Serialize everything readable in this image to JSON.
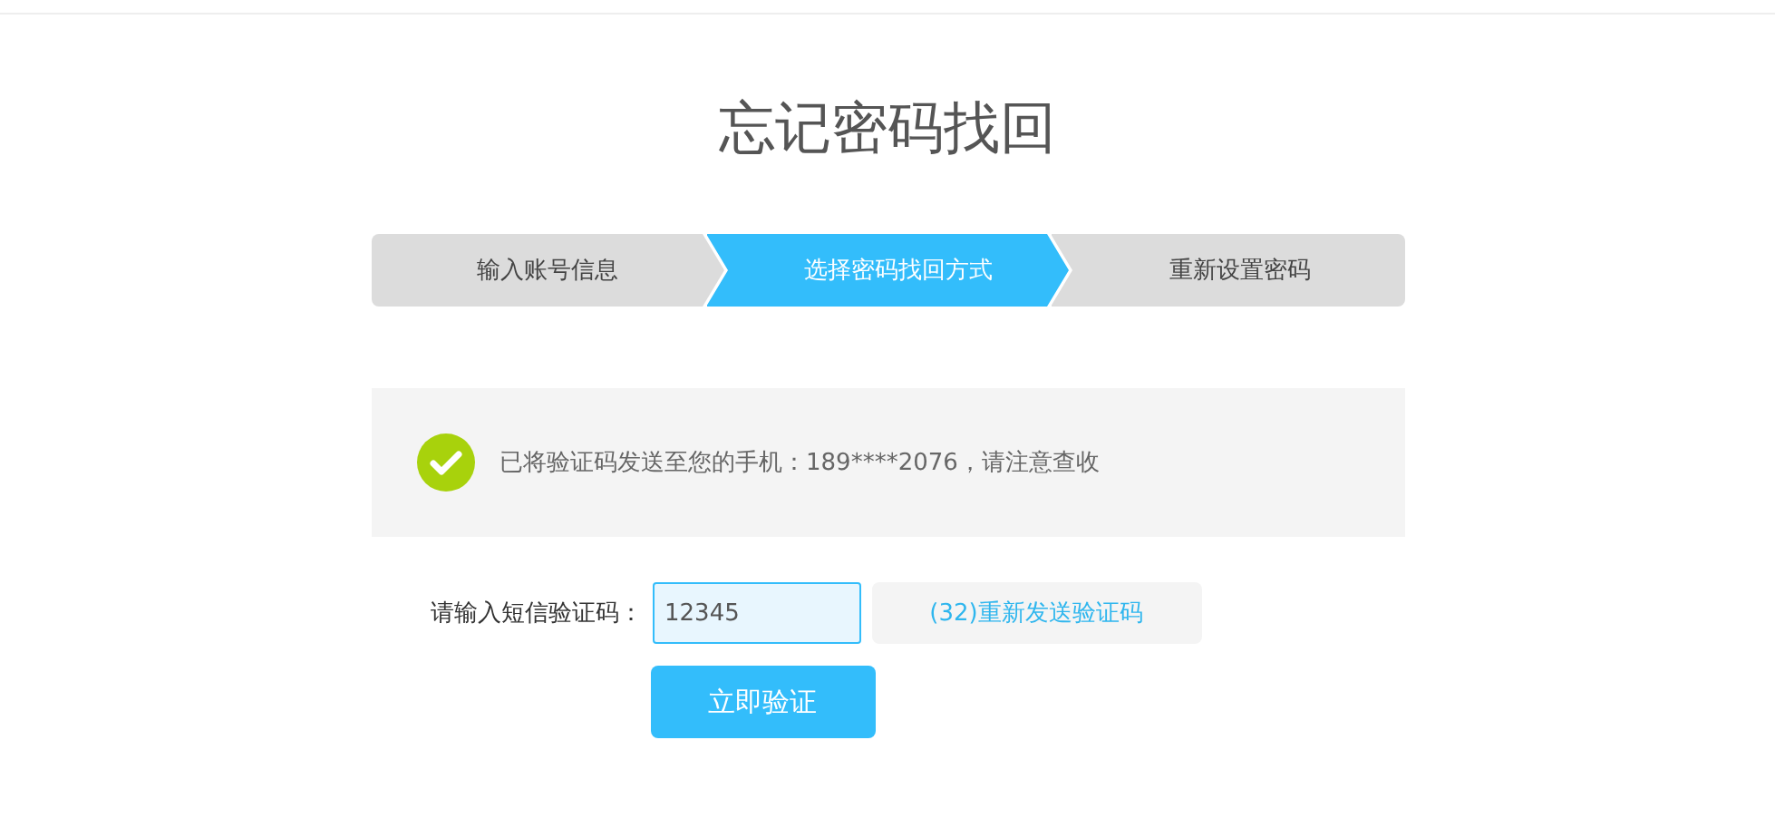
{
  "title": "忘记密码找回",
  "steps": [
    {
      "label": "输入账号信息",
      "selected": false
    },
    {
      "label": "选择密码找回方式",
      "selected": true
    },
    {
      "label": "重新设置密码",
      "selected": false
    }
  ],
  "notice": {
    "text": "已将验证码发送至您的手机：189****2076，请注意查收"
  },
  "form": {
    "label": "请输入短信验证码：",
    "value": "12345",
    "resend": "(32)重新发送验证码",
    "submit": "立即验证"
  }
}
